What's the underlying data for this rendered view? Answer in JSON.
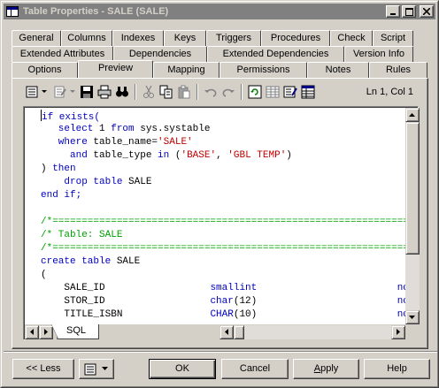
{
  "window": {
    "title": "Table Properties - SALE (SALE)",
    "controls": [
      "minimize",
      "maximize",
      "close"
    ]
  },
  "tabs": {
    "row1": [
      "General",
      "Columns",
      "Indexes",
      "Keys",
      "Triggers",
      "Procedures",
      "Check",
      "Script"
    ],
    "row2": [
      "Extended Attributes",
      "Dependencies",
      "Extended Dependencies",
      "Version Info"
    ],
    "row3": [
      "Options",
      "Preview",
      "Mapping",
      "Permissions",
      "Notes",
      "Rules"
    ],
    "active": "Preview"
  },
  "toolbar": {
    "icons": [
      "properties-menu-icon",
      "edit-menu-icon",
      "save-icon",
      "print-icon",
      "find-icon",
      "cut-icon",
      "copy-icon",
      "paste-icon",
      "undo-icon",
      "redo-icon",
      "refresh-icon",
      "table-icon",
      "options-icon",
      "grid-icon"
    ],
    "status": "Ln 1, Col 1"
  },
  "editor": {
    "lines": [
      [
        {
          "t": "if exists(",
          "c": "kw"
        }
      ],
      [
        {
          "t": "   select ",
          "c": "kw"
        },
        {
          "t": "1 ",
          "c": "plain"
        },
        {
          "t": "from ",
          "c": "kw"
        },
        {
          "t": "sys.systable",
          "c": "plain"
        }
      ],
      [
        {
          "t": "   where ",
          "c": "kw"
        },
        {
          "t": "table_name=",
          "c": "plain"
        },
        {
          "t": "'SALE'",
          "c": "str"
        }
      ],
      [
        {
          "t": "     and ",
          "c": "kw"
        },
        {
          "t": "table_type ",
          "c": "plain"
        },
        {
          "t": "in ",
          "c": "kw"
        },
        {
          "t": "(",
          "c": "plain"
        },
        {
          "t": "'BASE'",
          "c": "str"
        },
        {
          "t": ", ",
          "c": "plain"
        },
        {
          "t": "'GBL TEMP'",
          "c": "str"
        },
        {
          "t": ")",
          "c": "plain"
        }
      ],
      [
        {
          "t": ") ",
          "c": "plain"
        },
        {
          "t": "then",
          "c": "kw"
        }
      ],
      [
        {
          "t": "    drop table ",
          "c": "kw"
        },
        {
          "t": "SALE",
          "c": "plain"
        }
      ],
      [
        {
          "t": "end if;",
          "c": "kw"
        }
      ],
      [
        {
          "t": "",
          "c": "plain"
        }
      ],
      [
        {
          "t": "/*==============================================================",
          "c": "cmt"
        }
      ],
      [
        {
          "t": "/* Table: SALE",
          "c": "cmt"
        }
      ],
      [
        {
          "t": "/*==============================================================",
          "c": "cmt"
        }
      ],
      [
        {
          "t": "create table ",
          "c": "kw"
        },
        {
          "t": "SALE",
          "c": "plain"
        }
      ],
      [
        {
          "t": "(",
          "c": "plain"
        }
      ],
      [
        {
          "t": "    SALE_ID                  ",
          "c": "plain"
        },
        {
          "t": "smallint",
          "c": "kw"
        },
        {
          "t": "                        ",
          "c": "plain"
        },
        {
          "t": "not",
          "c": "kw"
        }
      ],
      [
        {
          "t": "    STOR_ID                  ",
          "c": "plain"
        },
        {
          "t": "char",
          "c": "kw"
        },
        {
          "t": "(12)",
          "c": "plain"
        },
        {
          "t": "                        ",
          "c": "plain"
        },
        {
          "t": "not",
          "c": "kw"
        }
      ],
      [
        {
          "t": "    TITLE_ISBN               ",
          "c": "plain"
        },
        {
          "t": "CHAR",
          "c": "kw"
        },
        {
          "t": "(10)",
          "c": "plain"
        },
        {
          "t": "                        ",
          "c": "plain"
        },
        {
          "t": "not",
          "c": "kw"
        }
      ]
    ],
    "bottom_tab": "SQL",
    "vertical_scroll_fraction": 0.0,
    "horizontal_scroll_fraction": 0.0
  },
  "buttons": {
    "less": "<< Less",
    "ok": "OK",
    "cancel": "Cancel",
    "apply": "Apply",
    "help": "Help"
  }
}
